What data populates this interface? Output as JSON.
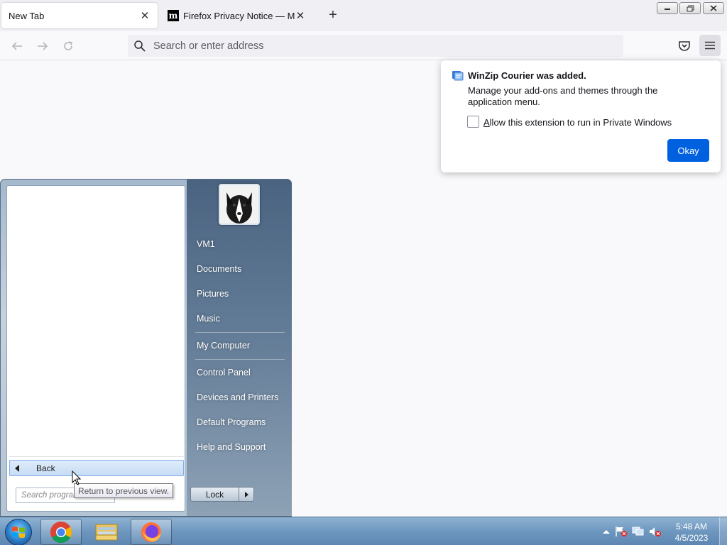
{
  "browser": {
    "tabs": [
      {
        "label": "New Tab",
        "active": true
      },
      {
        "label": "Firefox Privacy Notice — Mozilla",
        "active": false,
        "favicon": "m"
      }
    ],
    "new_tab_icon": "+",
    "address_placeholder": "Search or enter address",
    "window_controls": {
      "minimize": "minimize-icon",
      "restore": "restore-icon",
      "close": "close-icon"
    }
  },
  "doorhanger": {
    "title": "WinZip Courier was added.",
    "message": "Manage your add-ons and themes through the application menu.",
    "checkbox_label_prefix": "A",
    "checkbox_label_rest": "llow this extension to run in Private Windows",
    "checkbox_checked": false,
    "okay_label": "Okay",
    "accent_color": "#0061e0"
  },
  "start_menu": {
    "back_label": "Back",
    "search_placeholder": "Search programs and files",
    "tooltip": "Return to previous view.",
    "right_links": [
      "VM1",
      "Documents",
      "Pictures",
      "Music",
      "My Computer",
      "Control Panel",
      "Devices and Printers",
      "Default Programs",
      "Help and Support"
    ],
    "lock_label": "Lock"
  },
  "taskbar": {
    "apps": [
      "start-orb",
      "chrome",
      "windows-explorer",
      "firefox"
    ],
    "clock_time": "5:48 AM",
    "clock_date": "4/5/2023"
  }
}
